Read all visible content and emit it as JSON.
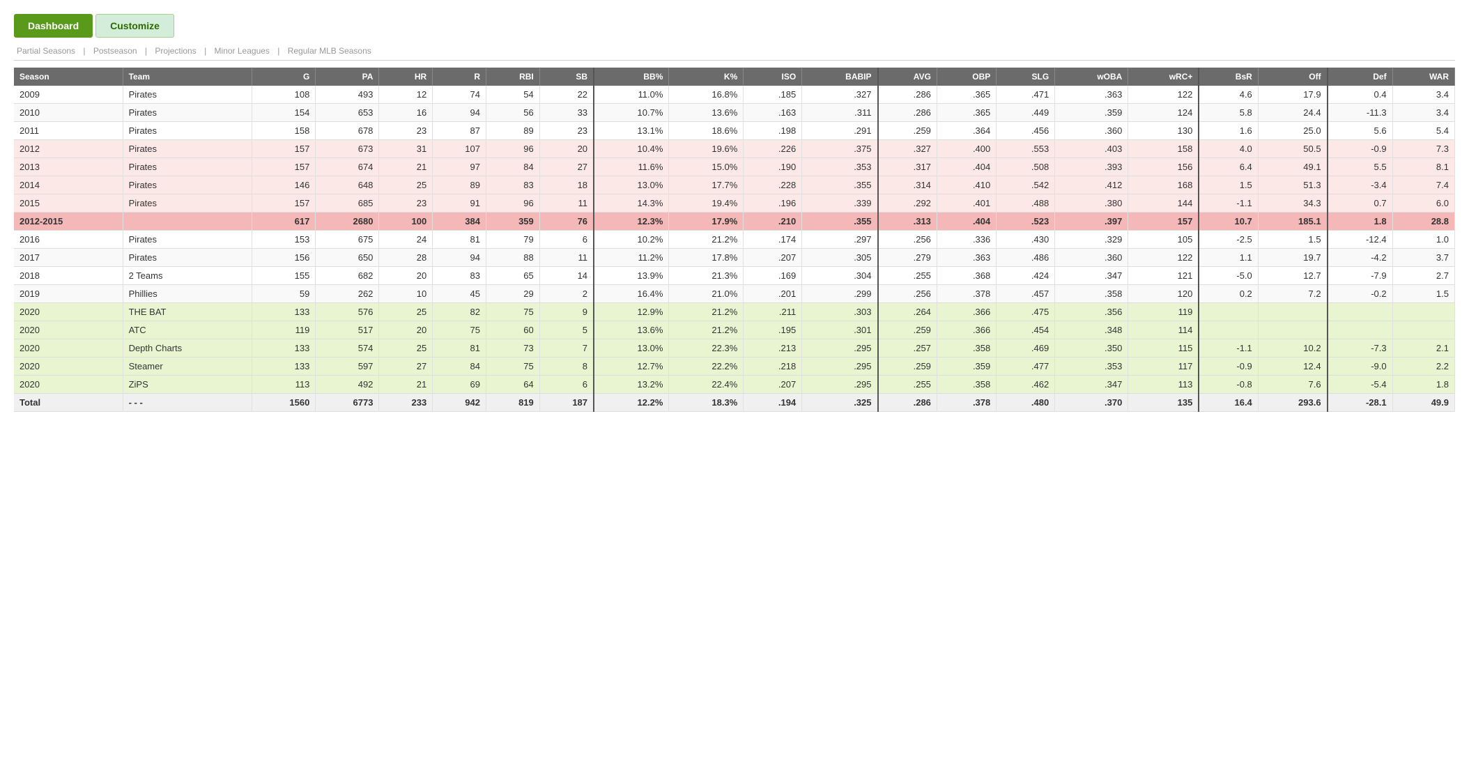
{
  "nav": {
    "buttons": [
      {
        "label": "Dashboard",
        "active": true
      },
      {
        "label": "Customize",
        "active": false
      }
    ]
  },
  "breadcrumb": {
    "items": [
      "Partial Seasons",
      "Postseason",
      "Projections",
      "Minor Leagues",
      "Regular MLB Seasons"
    ],
    "separator": "|"
  },
  "table": {
    "headers": [
      "Season",
      "Team",
      "G",
      "PA",
      "HR",
      "R",
      "RBI",
      "SB",
      "BB%",
      "K%",
      "ISO",
      "BABIP",
      "AVG",
      "OBP",
      "SLG",
      "wOBA",
      "wRC+",
      "BsR",
      "Off",
      "Def",
      "WAR"
    ],
    "rows": [
      {
        "season": "2009",
        "team": "Pirates",
        "g": "108",
        "pa": "493",
        "hr": "12",
        "r": "74",
        "rbi": "54",
        "sb": "22",
        "bb": "11.0%",
        "k": "16.8%",
        "iso": ".185",
        "babip": ".327",
        "avg": ".286",
        "obp": ".365",
        "slg": ".471",
        "woba": ".363",
        "wrc": "122",
        "bsr": "4.6",
        "off": "17.9",
        "def": "0.4",
        "war": "3.4",
        "style": ""
      },
      {
        "season": "2010",
        "team": "Pirates",
        "g": "154",
        "pa": "653",
        "hr": "16",
        "r": "94",
        "rbi": "56",
        "sb": "33",
        "bb": "10.7%",
        "k": "13.6%",
        "iso": ".163",
        "babip": ".311",
        "avg": ".286",
        "obp": ".365",
        "slg": ".449",
        "woba": ".359",
        "wrc": "124",
        "bsr": "5.8",
        "off": "24.4",
        "def": "-11.3",
        "war": "3.4",
        "style": ""
      },
      {
        "season": "2011",
        "team": "Pirates",
        "g": "158",
        "pa": "678",
        "hr": "23",
        "r": "87",
        "rbi": "89",
        "sb": "23",
        "bb": "13.1%",
        "k": "18.6%",
        "iso": ".198",
        "babip": ".291",
        "avg": ".259",
        "obp": ".364",
        "slg": ".456",
        "woba": ".360",
        "wrc": "130",
        "bsr": "1.6",
        "off": "25.0",
        "def": "5.6",
        "war": "5.4",
        "style": ""
      },
      {
        "season": "2012",
        "team": "Pirates",
        "g": "157",
        "pa": "673",
        "hr": "31",
        "r": "107",
        "rbi": "96",
        "sb": "20",
        "bb": "10.4%",
        "k": "19.6%",
        "iso": ".226",
        "babip": ".375",
        "avg": ".327",
        "obp": ".400",
        "slg": ".553",
        "woba": ".403",
        "wrc": "158",
        "bsr": "4.0",
        "off": "50.5",
        "def": "-0.9",
        "war": "7.3",
        "style": "red-light"
      },
      {
        "season": "2013",
        "team": "Pirates",
        "g": "157",
        "pa": "674",
        "hr": "21",
        "r": "97",
        "rbi": "84",
        "sb": "27",
        "bb": "11.6%",
        "k": "15.0%",
        "iso": ".190",
        "babip": ".353",
        "avg": ".317",
        "obp": ".404",
        "slg": ".508",
        "woba": ".393",
        "wrc": "156",
        "bsr": "6.4",
        "off": "49.1",
        "def": "5.5",
        "war": "8.1",
        "style": "red-light"
      },
      {
        "season": "2014",
        "team": "Pirates",
        "g": "146",
        "pa": "648",
        "hr": "25",
        "r": "89",
        "rbi": "83",
        "sb": "18",
        "bb": "13.0%",
        "k": "17.7%",
        "iso": ".228",
        "babip": ".355",
        "avg": ".314",
        "obp": ".410",
        "slg": ".542",
        "woba": ".412",
        "wrc": "168",
        "bsr": "1.5",
        "off": "51.3",
        "def": "-3.4",
        "war": "7.4",
        "style": "red-light"
      },
      {
        "season": "2015",
        "team": "Pirates",
        "g": "157",
        "pa": "685",
        "hr": "23",
        "r": "91",
        "rbi": "96",
        "sb": "11",
        "bb": "14.3%",
        "k": "19.4%",
        "iso": ".196",
        "babip": ".339",
        "avg": ".292",
        "obp": ".401",
        "slg": ".488",
        "woba": ".380",
        "wrc": "144",
        "bsr": "-1.1",
        "off": "34.3",
        "def": "0.7",
        "war": "6.0",
        "style": "red-light"
      },
      {
        "season": "2012-2015",
        "team": "",
        "g": "617",
        "pa": "2680",
        "hr": "100",
        "r": "384",
        "rbi": "359",
        "sb": "76",
        "bb": "12.3%",
        "k": "17.9%",
        "iso": ".210",
        "babip": ".355",
        "avg": ".313",
        "obp": ".404",
        "slg": ".523",
        "woba": ".397",
        "wrc": "157",
        "bsr": "10.7",
        "off": "185.1",
        "def": "1.8",
        "war": "28.8",
        "style": "red-bold"
      },
      {
        "season": "2016",
        "team": "Pirates",
        "g": "153",
        "pa": "675",
        "hr": "24",
        "r": "81",
        "rbi": "79",
        "sb": "6",
        "bb": "10.2%",
        "k": "21.2%",
        "iso": ".174",
        "babip": ".297",
        "avg": ".256",
        "obp": ".336",
        "slg": ".430",
        "woba": ".329",
        "wrc": "105",
        "bsr": "-2.5",
        "off": "1.5",
        "def": "-12.4",
        "war": "1.0",
        "style": ""
      },
      {
        "season": "2017",
        "team": "Pirates",
        "g": "156",
        "pa": "650",
        "hr": "28",
        "r": "94",
        "rbi": "88",
        "sb": "11",
        "bb": "11.2%",
        "k": "17.8%",
        "iso": ".207",
        "babip": ".305",
        "avg": ".279",
        "obp": ".363",
        "slg": ".486",
        "woba": ".360",
        "wrc": "122",
        "bsr": "1.1",
        "off": "19.7",
        "def": "-4.2",
        "war": "3.7",
        "style": ""
      },
      {
        "season": "2018",
        "team": "2 Teams",
        "g": "155",
        "pa": "682",
        "hr": "20",
        "r": "83",
        "rbi": "65",
        "sb": "14",
        "bb": "13.9%",
        "k": "21.3%",
        "iso": ".169",
        "babip": ".304",
        "avg": ".255",
        "obp": ".368",
        "slg": ".424",
        "woba": ".347",
        "wrc": "121",
        "bsr": "-5.0",
        "off": "12.7",
        "def": "-7.9",
        "war": "2.7",
        "style": ""
      },
      {
        "season": "2019",
        "team": "Phillies",
        "g": "59",
        "pa": "262",
        "hr": "10",
        "r": "45",
        "rbi": "29",
        "sb": "2",
        "bb": "16.4%",
        "k": "21.0%",
        "iso": ".201",
        "babip": ".299",
        "avg": ".256",
        "obp": ".378",
        "slg": ".457",
        "woba": ".358",
        "wrc": "120",
        "bsr": "0.2",
        "off": "7.2",
        "def": "-0.2",
        "war": "1.5",
        "style": ""
      },
      {
        "season": "2020",
        "team": "THE BAT",
        "g": "133",
        "pa": "576",
        "hr": "25",
        "r": "82",
        "rbi": "75",
        "sb": "9",
        "bb": "12.9%",
        "k": "21.2%",
        "iso": ".211",
        "babip": ".303",
        "avg": ".264",
        "obp": ".366",
        "slg": ".475",
        "woba": ".356",
        "wrc": "119",
        "bsr": "",
        "off": "",
        "def": "",
        "war": "",
        "style": "green"
      },
      {
        "season": "2020",
        "team": "ATC",
        "g": "119",
        "pa": "517",
        "hr": "20",
        "r": "75",
        "rbi": "60",
        "sb": "5",
        "bb": "13.6%",
        "k": "21.2%",
        "iso": ".195",
        "babip": ".301",
        "avg": ".259",
        "obp": ".366",
        "slg": ".454",
        "woba": ".348",
        "wrc": "114",
        "bsr": "",
        "off": "",
        "def": "",
        "war": "",
        "style": "green"
      },
      {
        "season": "2020",
        "team": "Depth Charts",
        "g": "133",
        "pa": "574",
        "hr": "25",
        "r": "81",
        "rbi": "73",
        "sb": "7",
        "bb": "13.0%",
        "k": "22.3%",
        "iso": ".213",
        "babip": ".295",
        "avg": ".257",
        "obp": ".358",
        "slg": ".469",
        "woba": ".350",
        "wrc": "115",
        "bsr": "-1.1",
        "off": "10.2",
        "def": "-7.3",
        "war": "2.1",
        "style": "green"
      },
      {
        "season": "2020",
        "team": "Steamer",
        "g": "133",
        "pa": "597",
        "hr": "27",
        "r": "84",
        "rbi": "75",
        "sb": "8",
        "bb": "12.7%",
        "k": "22.2%",
        "iso": ".218",
        "babip": ".295",
        "avg": ".259",
        "obp": ".359",
        "slg": ".477",
        "woba": ".353",
        "wrc": "117",
        "bsr": "-0.9",
        "off": "12.4",
        "def": "-9.0",
        "war": "2.2",
        "style": "green"
      },
      {
        "season": "2020",
        "team": "ZiPS",
        "g": "113",
        "pa": "492",
        "hr": "21",
        "r": "69",
        "rbi": "64",
        "sb": "6",
        "bb": "13.2%",
        "k": "22.4%",
        "iso": ".207",
        "babip": ".295",
        "avg": ".255",
        "obp": ".358",
        "slg": ".462",
        "woba": ".347",
        "wrc": "113",
        "bsr": "-0.8",
        "off": "7.6",
        "def": "-5.4",
        "war": "1.8",
        "style": "green"
      },
      {
        "season": "Total",
        "team": "- - -",
        "g": "1560",
        "pa": "6773",
        "hr": "233",
        "r": "942",
        "rbi": "819",
        "sb": "187",
        "bb": "12.2%",
        "k": "18.3%",
        "iso": ".194",
        "babip": ".325",
        "avg": ".286",
        "obp": ".378",
        "slg": ".480",
        "woba": ".370",
        "wrc": "135",
        "bsr": "16.4",
        "off": "293.6",
        "def": "-28.1",
        "war": "49.9",
        "style": "total"
      }
    ]
  }
}
